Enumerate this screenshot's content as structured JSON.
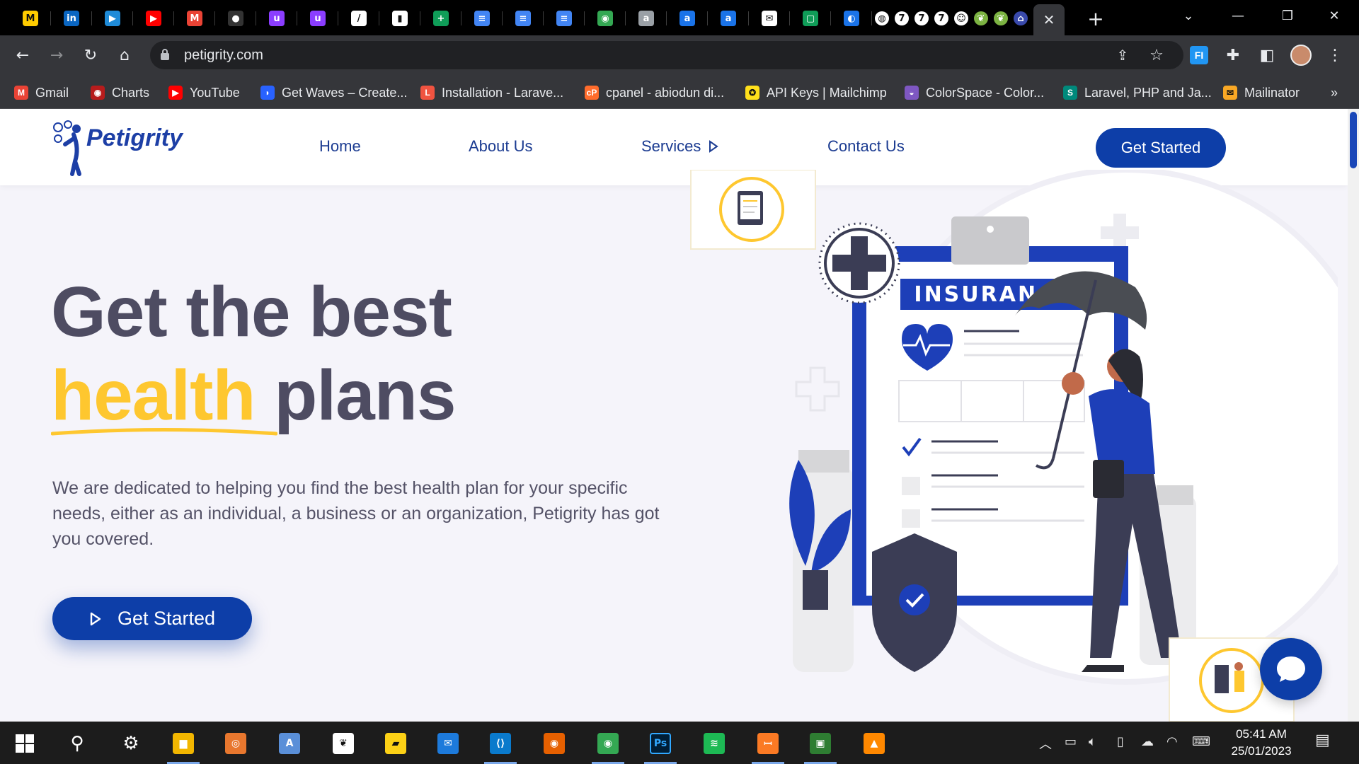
{
  "browser": {
    "tabs": [
      {
        "icon": "mtn-icon",
        "color": "#ffcc00",
        "glyph": "M"
      },
      {
        "icon": "linkedin-icon",
        "color": "#0a66c2",
        "glyph": "in"
      },
      {
        "icon": "video-icon",
        "color": "#1f8bd8",
        "glyph": "▶"
      },
      {
        "icon": "youtube-icon",
        "color": "#ff0000",
        "glyph": "▶"
      },
      {
        "icon": "gmail-icon",
        "color": "#ea4335",
        "glyph": "M"
      },
      {
        "icon": "github-icon",
        "color": "#333333",
        "glyph": "●"
      },
      {
        "icon": "udemy-icon",
        "color": "#8b3dff",
        "glyph": "u"
      },
      {
        "icon": "udemy-icon",
        "color": "#8b3dff",
        "glyph": "u"
      },
      {
        "icon": "slash-icon",
        "color": "#ffffff",
        "glyph": "/"
      },
      {
        "icon": "trello-icon",
        "color": "#ffffff",
        "glyph": "▮"
      },
      {
        "icon": "sheets-icon",
        "color": "#0f9d58",
        "glyph": "+"
      },
      {
        "icon": "docs-icon",
        "color": "#4285f4",
        "glyph": "≡"
      },
      {
        "icon": "docs-icon",
        "color": "#4285f4",
        "glyph": "≡"
      },
      {
        "icon": "docs-icon",
        "color": "#4285f4",
        "glyph": "≡"
      },
      {
        "icon": "globe-icon",
        "color": "#34a853",
        "glyph": "◉"
      },
      {
        "icon": "a-icon",
        "color": "#9aa0a6",
        "glyph": "a"
      },
      {
        "icon": "a-icon",
        "color": "#1a73e8",
        "glyph": "a"
      },
      {
        "icon": "a-icon",
        "color": "#1a73e8",
        "glyph": "a"
      },
      {
        "icon": "email-icon",
        "color": "#ffffff",
        "glyph": "✉"
      },
      {
        "icon": "terminal-icon",
        "color": "#0f9d58",
        "glyph": "▢"
      },
      {
        "icon": "app-icon",
        "color": "#1a73e8",
        "glyph": "◐"
      }
    ],
    "narrow_tabs": [
      {
        "icon": "globe-icon",
        "color": "#ffffff",
        "glyph": "◍"
      },
      {
        "icon": "seven-icon",
        "color": "#ffffff",
        "glyph": "7"
      },
      {
        "icon": "seven-icon",
        "color": "#ffffff",
        "glyph": "7"
      },
      {
        "icon": "seven-icon",
        "color": "#ffffff",
        "glyph": "7"
      },
      {
        "icon": "smiley-icon",
        "color": "#ffffff",
        "glyph": "☺"
      },
      {
        "icon": "leaf-icon",
        "color": "#7cb342",
        "glyph": "❦"
      },
      {
        "icon": "leaf-icon",
        "color": "#7cb342",
        "glyph": "❦"
      },
      {
        "icon": "bank-icon",
        "color": "#3949ab",
        "glyph": "⌂"
      }
    ],
    "active_tab_close": "✕",
    "new_tab": "+",
    "url": "petigrity.com",
    "bookmarks": [
      {
        "label": "Gmail",
        "icon": "gmail-icon",
        "color": "#ea4335",
        "glyph": "M"
      },
      {
        "label": "Charts",
        "icon": "charts-icon",
        "color": "#b71c1c",
        "glyph": "◉"
      },
      {
        "label": "YouTube",
        "icon": "youtube-icon",
        "color": "#ff0000",
        "glyph": "▶"
      },
      {
        "label": "Get Waves – Create...",
        "icon": "waves-icon",
        "color": "#2962ff",
        "glyph": "◗"
      },
      {
        "label": "Installation - Larave...",
        "icon": "laravel-icon",
        "color": "#f05340",
        "glyph": "L"
      },
      {
        "label": "cpanel - abiodun di...",
        "icon": "cpanel-icon",
        "color": "#ff6c2c",
        "glyph": "cP"
      },
      {
        "label": "API Keys | Mailchimp",
        "icon": "mailchimp-icon",
        "color": "#ffe01b",
        "glyph": "✪"
      },
      {
        "label": "ColorSpace - Color...",
        "icon": "colorspace-icon",
        "color": "#7e57c2",
        "glyph": "◒"
      },
      {
        "label": "Laravel, PHP and Ja...",
        "icon": "s-icon",
        "color": "#00897b",
        "glyph": "S"
      },
      {
        "label": "Mailinator",
        "icon": "mailinator-icon",
        "color": "#f9a825",
        "glyph": "✉"
      }
    ],
    "bookmarks_more": "»"
  },
  "site": {
    "brand": "Petigrity",
    "nav": [
      "Home",
      "About Us",
      "Services",
      "Contact Us"
    ],
    "nav_cta": "Get Started",
    "hero": {
      "line1": "Get the best",
      "accent": "health",
      "rest": "plans",
      "paragraph": "We are dedicated to helping you find the best health plan for your specific needs, either as an individual, a business or an organization, Petigrity has got you covered.",
      "cta": "Get Started"
    },
    "illustration": {
      "label": "INSURANCE"
    },
    "colors": {
      "primary": "#0d3ea8",
      "accent": "#fec72f",
      "heading": "#4e4c62"
    }
  },
  "taskbar": {
    "apps": [
      {
        "name": "settings",
        "icon": "gear-icon",
        "color": "#3a3a3a",
        "glyph": "⚙"
      },
      {
        "name": "file-explorer",
        "icon": "folder-icon",
        "color": "#f2b600",
        "glyph": "▆"
      },
      {
        "name": "app-orange",
        "icon": "camera-icon",
        "color": "#e8772e",
        "glyph": "◎"
      },
      {
        "name": "notepad",
        "icon": "notepad-icon",
        "color": "#5a8fd8",
        "glyph": "A"
      },
      {
        "name": "mongodb",
        "icon": "leaf-icon",
        "color": "#ffffff",
        "glyph": "❦"
      },
      {
        "name": "sticky-notes",
        "icon": "sticky-note-icon",
        "color": "#fcd116",
        "glyph": "▰"
      },
      {
        "name": "mail",
        "icon": "mail-icon",
        "color": "#1d7adb",
        "glyph": "✉"
      },
      {
        "name": "vscode",
        "icon": "vscode-icon",
        "color": "#0a7acc",
        "glyph": "⟨⟩"
      },
      {
        "name": "firefox",
        "icon": "firefox-icon",
        "color": "#e66000",
        "glyph": "◉"
      },
      {
        "name": "chrome",
        "icon": "chrome-icon",
        "color": "#34a853",
        "glyph": "◉"
      },
      {
        "name": "photoshop",
        "icon": "photoshop-icon",
        "color": "#001e36",
        "glyph": "Ps"
      },
      {
        "name": "spotify",
        "icon": "spotify-icon",
        "color": "#1db954",
        "glyph": "≋"
      },
      {
        "name": "xampp",
        "icon": "xampp-icon",
        "color": "#fb7a24",
        "glyph": "ꟷ"
      },
      {
        "name": "app-green",
        "icon": "window-icon",
        "color": "#2e7d32",
        "glyph": "▣"
      },
      {
        "name": "vlc",
        "icon": "vlc-icon",
        "color": "#ff8800",
        "glyph": "▲"
      }
    ],
    "time": "05:41 AM",
    "date": "25/01/2023"
  }
}
